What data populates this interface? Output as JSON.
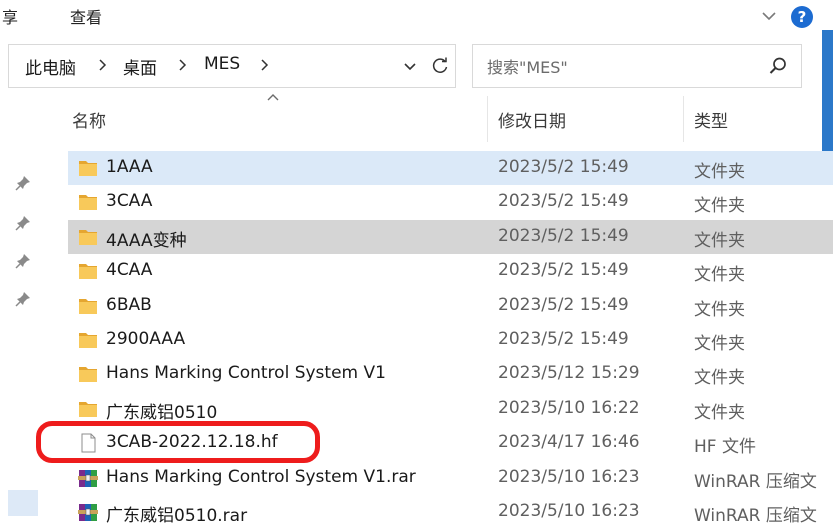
{
  "ribbon": {
    "left_label": "享",
    "view_label": "查看"
  },
  "address": {
    "crumbs": [
      "此电脑",
      "桌面",
      "MES"
    ]
  },
  "search": {
    "placeholder": "搜索\"MES\""
  },
  "columns": {
    "name": "名称",
    "date": "修改日期",
    "type": "类型"
  },
  "files": [
    {
      "name": "1AAA",
      "date": "2023/5/2 15:49",
      "type": "文件夹",
      "kind": "folder",
      "state": "selected"
    },
    {
      "name": "3CAA",
      "date": "2023/5/2 15:49",
      "type": "文件夹",
      "kind": "folder",
      "state": ""
    },
    {
      "name": "4AAA变种",
      "date": "2023/5/2 15:49",
      "type": "文件夹",
      "kind": "folder",
      "state": "hover"
    },
    {
      "name": "4CAA",
      "date": "2023/5/2 15:49",
      "type": "文件夹",
      "kind": "folder",
      "state": ""
    },
    {
      "name": "6BAB",
      "date": "2023/5/2 15:49",
      "type": "文件夹",
      "kind": "folder",
      "state": ""
    },
    {
      "name": "2900AAA",
      "date": "2023/5/2 15:49",
      "type": "文件夹",
      "kind": "folder",
      "state": ""
    },
    {
      "name": "Hans Marking Control System V1",
      "date": "2023/5/12 15:29",
      "type": "文件夹",
      "kind": "folder",
      "state": ""
    },
    {
      "name": "广东威铝0510",
      "date": "2023/5/10 16:22",
      "type": "文件夹",
      "kind": "folder",
      "state": ""
    },
    {
      "name": "3CAB-2022.12.18.hf",
      "date": "2023/4/17 16:46",
      "type": "HF 文件",
      "kind": "file",
      "state": ""
    },
    {
      "name": "Hans Marking Control System V1.rar",
      "date": "2023/5/10 16:23",
      "type": "WinRAR 压缩文",
      "kind": "rar",
      "state": ""
    },
    {
      "name": "广东威铝0510.rar",
      "date": "2023/5/10 16:23",
      "type": "WinRAR 压缩文",
      "kind": "rar",
      "state": ""
    }
  ],
  "colors": {
    "folder": "#f8c95a",
    "selection": "#dbe9f8",
    "hover": "#d5d5d5",
    "annotation": "#ee1c1c",
    "accent": "#1c6bd1"
  },
  "icons": [
    "chevron-down-icon",
    "help-icon",
    "chevron-right-icon",
    "refresh-icon",
    "search-icon",
    "pin-icon",
    "folder-icon",
    "file-icon",
    "winrar-icon"
  ]
}
